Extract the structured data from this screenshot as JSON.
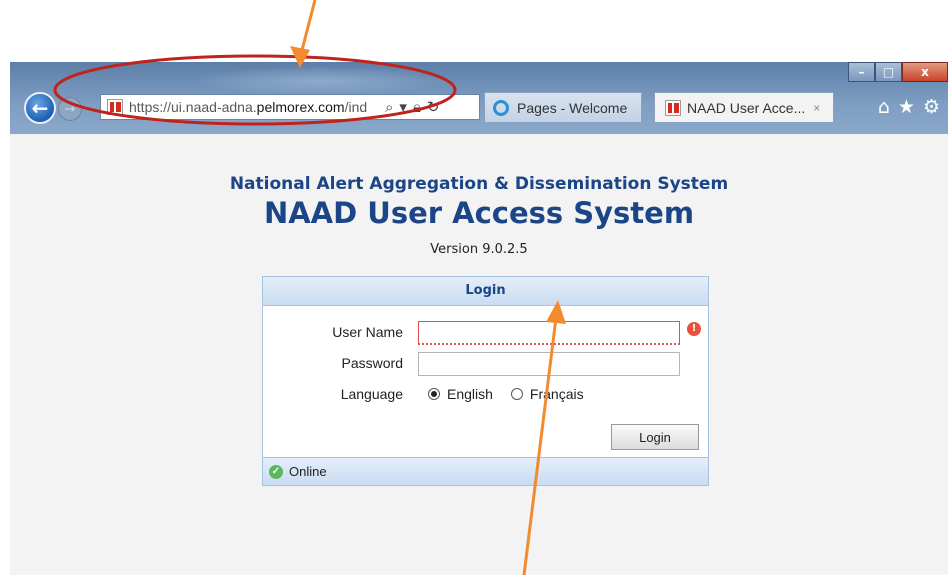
{
  "browser": {
    "url_prefix": "https://ui.naad-adna.",
    "url_host": "pelmorex.com",
    "url_suffix": "/ind",
    "tabs": [
      {
        "label": "Pages - Welcome"
      },
      {
        "label": "NAAD User Acce...",
        "close": "×"
      }
    ],
    "window_controls": {
      "minimize": "–",
      "maximize": "□",
      "close": "x"
    }
  },
  "page": {
    "subtitle": "National Alert Aggregation & Dissemination System",
    "title": "NAAD User Access System",
    "version": "Version 9.0.2.5"
  },
  "login": {
    "header": "Login",
    "username_label": "User Name",
    "username_value": "",
    "password_label": "Password",
    "password_value": "",
    "language_label": "Language",
    "languages": [
      {
        "label": "English",
        "selected": true
      },
      {
        "label": "Français",
        "selected": false
      }
    ],
    "login_button": "Login",
    "status": "Online",
    "error_icon": "!"
  },
  "colors": {
    "title_blue": "#1c4587",
    "annotation_orange": "#f28a2e",
    "annotation_red": "#c0221c"
  }
}
